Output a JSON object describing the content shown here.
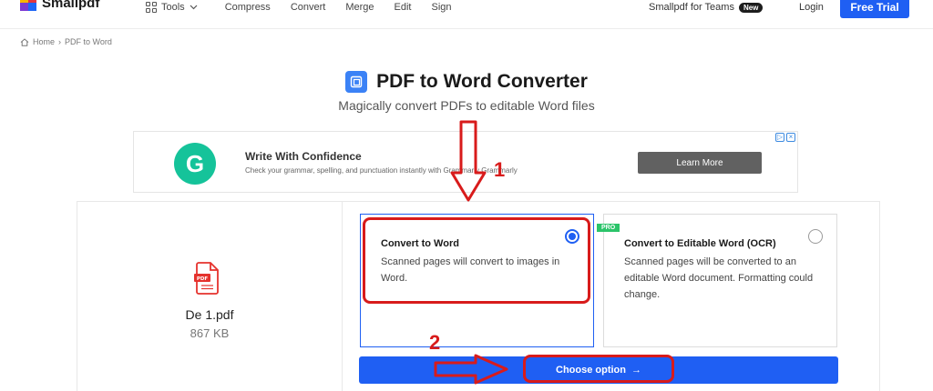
{
  "app": {
    "logo_text": "Smallpdf",
    "brand_color": "#1f5ff3"
  },
  "nav": {
    "tools_label": "Tools",
    "links": [
      "Compress",
      "Convert",
      "Merge",
      "Edit",
      "Sign"
    ],
    "teams_label": "Smallpdf for Teams",
    "new_badge": "New",
    "login_label": "Login",
    "free_trial_label": "Free Trial"
  },
  "breadcrumb": {
    "home": "Home",
    "separator": "›",
    "current": "PDF to Word"
  },
  "page": {
    "title": "PDF to Word Converter",
    "subtitle": "Magically convert PDFs to editable Word files"
  },
  "ad": {
    "logo_letter": "G",
    "title": "Write With Confidence",
    "description": "Check your grammar, spelling, and punctuation instantly with Grammarly Grammarly",
    "button_label": "Learn More"
  },
  "file": {
    "name": "De 1.pdf",
    "size": "867 KB",
    "icon_label": "PDF"
  },
  "options": [
    {
      "title": "Convert to Word",
      "description": "Scanned pages will convert to images in Word.",
      "selected": true
    },
    {
      "title": "Convert to Editable Word (OCR)",
      "description": "Scanned pages will be converted to an editable Word document. Formatting could change.",
      "badge": "PRO",
      "selected": false
    }
  ],
  "choose_button": {
    "label": "Choose option",
    "arrow": "→"
  },
  "annotations": {
    "step1": "1",
    "step2": "2",
    "color": "#d81b1b"
  }
}
